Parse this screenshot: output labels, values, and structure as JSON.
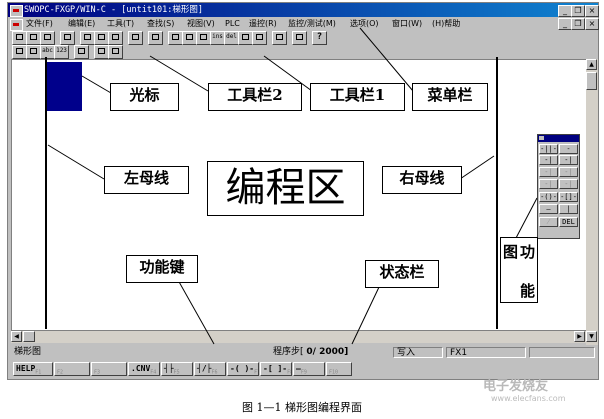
{
  "window": {
    "title": "SWOPC-FXGP/WIN-C - [untit101:梯形图]",
    "controls": {
      "minimize": "_",
      "restore": "❐",
      "close": "×"
    },
    "doc_controls": {
      "minimize": "_",
      "restore": "❐",
      "close": "×"
    }
  },
  "menu": {
    "items": [
      {
        "label": "文件(F)"
      },
      {
        "label": "编辑(E)"
      },
      {
        "label": "工具(T)"
      },
      {
        "label": "查找(S)"
      },
      {
        "label": "视图(V)"
      },
      {
        "label": "PLC"
      },
      {
        "label": "遥控(R)"
      },
      {
        "label": "监控/测试(M)"
      },
      {
        "label": "选项(O)"
      },
      {
        "label": "窗口(W)"
      },
      {
        "label": "(H)帮助"
      }
    ]
  },
  "toolbar1": {
    "buttons": [
      "new",
      "open",
      "save",
      "print",
      "cut",
      "copy",
      "paste",
      "pdf",
      "zoom-in",
      "f1",
      "f2",
      "f3",
      "f4",
      "f5",
      "f6",
      "f7",
      "help"
    ],
    "labels": {
      "b_ins": "ins",
      "b_del": "del",
      "help": "?"
    }
  },
  "toolbar2": {
    "labels": {
      "b1": "",
      "b2": "",
      "b3": "abc",
      "b4": "123"
    }
  },
  "annotations": {
    "cursor": "光标",
    "toolbar2": "工具栏2",
    "toolbar1": "工具栏1",
    "menubar": "菜单栏",
    "left_bus": "左母线",
    "edit_area": "编程区",
    "right_bus": "右母线",
    "function_keys": "功能键",
    "status_bar": "状态栏",
    "function_palette": [
      "图",
      "功",
      "能"
    ]
  },
  "palette": {
    "buttons": [
      "-||-",
      "-|/|-",
      "-|↑|-",
      "-|↓|-",
      "-|↑|-",
      "-|↓|-",
      "-|↑|-",
      "-|↓|-",
      "-()-",
      "-[]-",
      "—",
      "|",
      "⁄",
      "DEL"
    ]
  },
  "status": {
    "mode": "梯形图",
    "step_label": "程序步[",
    "step_value": "0/ 2000]",
    "write_mode": "写入",
    "plc_type": "FX1"
  },
  "fkeys": [
    {
      "label": "HELP",
      "sub": "F1"
    },
    {
      "label": "",
      "sub": "F2"
    },
    {
      "label": "",
      "sub": "F3"
    },
    {
      "label": ".CNV",
      "sub": "F4"
    },
    {
      "label": "┤├",
      "sub": "F5"
    },
    {
      "label": "┤/├",
      "sub": "F6"
    },
    {
      "label": "-( )-",
      "sub": "F7"
    },
    {
      "label": "-[ ]-",
      "sub": "F8"
    },
    {
      "label": "—",
      "sub": "F9"
    },
    {
      "label": "",
      "sub": "F10"
    }
  ],
  "caption": "图 1—1 梯形图编程界面",
  "watermark": {
    "main": "电子发烧友",
    "sub": "www.elecfans.com"
  }
}
